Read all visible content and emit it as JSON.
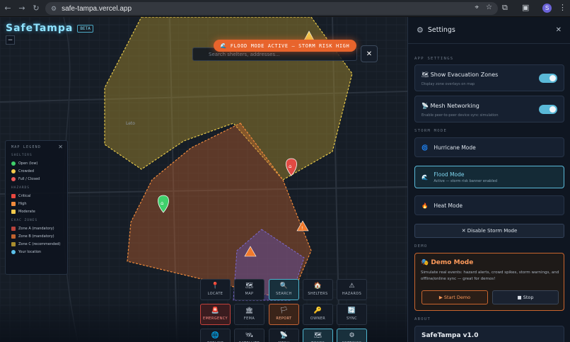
{
  "browser": {
    "url": "safe-tampa.vercel.app",
    "back_icon": "arrow-left-icon",
    "forward_icon": "arrow-right-icon",
    "reload_icon": "reload-icon",
    "avatar_initial": "S"
  },
  "brand": {
    "name": "SafeTampa",
    "badge": "BETA"
  },
  "map": {
    "zoom_out_label": "−",
    "place_label": "Leto",
    "alert_banner": "🌊 FLOOD MODE ACTIVE — STORM RISK HIGH",
    "search_placeholder": "Search shelters, addresses...",
    "search_close": "✕"
  },
  "legend": {
    "title": "MAP LEGEND",
    "close": "✕",
    "sections": [
      {
        "heading": "SHELTERS",
        "items": [
          {
            "label": "Open (low)",
            "color": "#3fd06b",
            "shape": "dot"
          },
          {
            "label": "Crowded",
            "color": "#f2c94c",
            "shape": "dot"
          },
          {
            "label": "Full / Closed",
            "color": "#eb5757",
            "shape": "dot"
          }
        ]
      },
      {
        "heading": "HAZARDS",
        "items": [
          {
            "label": "Critical",
            "color": "#e8473f",
            "shape": "sq"
          },
          {
            "label": "High",
            "color": "#f08a3c",
            "shape": "sq"
          },
          {
            "label": "Moderate",
            "color": "#f2c94c",
            "shape": "sq"
          }
        ]
      },
      {
        "heading": "EVAC ZONES",
        "items": [
          {
            "label": "Zone A (mandatory)",
            "color": "#b8433c",
            "shape": "sq"
          },
          {
            "label": "Zone B (mandatory)",
            "color": "#c0622e",
            "shape": "sq"
          },
          {
            "label": "Zone C (recommended)",
            "color": "#a88d2e",
            "shape": "sq"
          },
          {
            "label": "Your location",
            "color": "#5bc0ea",
            "shape": "dot"
          }
        ]
      }
    ]
  },
  "toolbar": {
    "buttons": [
      {
        "label": "LOCATE",
        "icon": "📍",
        "icon_name": "pin-icon",
        "style": ""
      },
      {
        "label": "MAP",
        "icon": "🗺",
        "icon_name": "map-icon",
        "style": ""
      },
      {
        "label": "SEARCH",
        "icon": "🔍",
        "icon_name": "search-icon",
        "style": "cyan"
      },
      {
        "label": "SHELTERS",
        "icon": "🏠",
        "icon_name": "shelter-icon",
        "style": ""
      },
      {
        "label": "HAZARDS",
        "icon": "⚠",
        "icon_name": "warning-icon",
        "style": ""
      },
      {
        "label": "EMERGENCY",
        "icon": "🚨",
        "icon_name": "emergency-icon",
        "style": "red"
      },
      {
        "label": "FEMA",
        "icon": "🏛",
        "icon_name": "government-building-icon",
        "style": ""
      },
      {
        "label": "REPORT",
        "icon": "🏳",
        "icon_name": "flag-icon",
        "style": "orange"
      },
      {
        "label": "OWNER",
        "icon": "🔑",
        "icon_name": "key-icon",
        "style": ""
      },
      {
        "label": "SYNC",
        "icon": "🔄",
        "icon_name": "sync-icon",
        "style": ""
      },
      {
        "label": "OFFLINE",
        "icon": "🌐",
        "icon_name": "globe-icon",
        "style": ""
      },
      {
        "label": "SATELLITE",
        "icon": "🛰",
        "icon_name": "satellite-icon",
        "style": ""
      },
      {
        "label": "MESH",
        "icon": "📡",
        "icon_name": "antenna-icon",
        "style": ""
      },
      {
        "label": "ZONES",
        "icon": "🗺",
        "icon_name": "zones-icon",
        "style": "cyan"
      },
      {
        "label": "SETTINGS",
        "icon": "⚙",
        "icon_name": "gear-icon",
        "style": "cyan"
      }
    ]
  },
  "settings": {
    "title": "Settings",
    "close": "✕",
    "app_settings_heading": "APP SETTINGS",
    "evac": {
      "title": "🗺 Show Evacuation Zones",
      "subtitle": "Display zone overlays on map",
      "on": true
    },
    "mesh": {
      "title": "📡 Mesh Networking",
      "subtitle": "Enable peer-to-peer device sync simulation",
      "on": true
    },
    "storm_heading": "STORM MODE",
    "modes": [
      {
        "icon": "🌀",
        "label": "Hurricane Mode",
        "sub": "",
        "active": false
      },
      {
        "icon": "🌊",
        "label": "Flood Mode",
        "sub": "Active — storm risk banner enabled",
        "active": true
      },
      {
        "icon": "🔥",
        "label": "Heat Mode",
        "sub": "",
        "active": false
      }
    ],
    "disable_storm": "✕ Disable Storm Mode",
    "demo_heading": "DEMO",
    "demo": {
      "title": "🎭 Demo Mode",
      "description": "Simulate real events: hazard alerts, crowd spikes, storm warnings, and offline/online sync — great for demos!",
      "start": "▶ Start Demo",
      "stop": "■ Stop"
    },
    "about_heading": "ABOUT",
    "about_title": "SafeTampa v1.0"
  }
}
